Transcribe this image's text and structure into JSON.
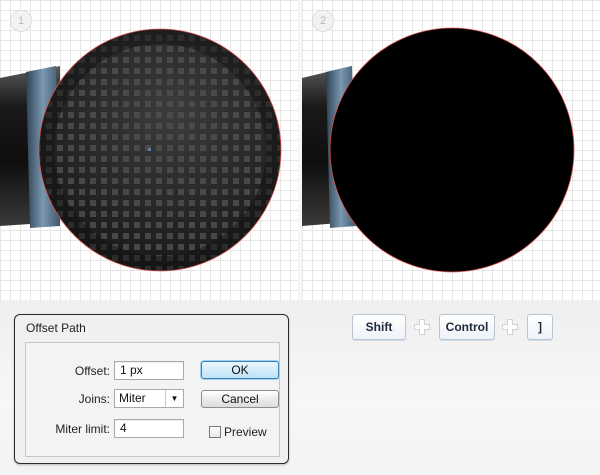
{
  "panels": [
    {
      "step": "1"
    },
    {
      "step": "2"
    }
  ],
  "dialog": {
    "title": "Offset Path",
    "offset_label": "Offset:",
    "offset_value": "1 px",
    "joins_label": "Joins:",
    "joins_value": "Miter",
    "miter_label": "Miter limit:",
    "miter_value": "4",
    "ok_label": "OK",
    "cancel_label": "Cancel",
    "preview_label": "Preview",
    "preview_checked": false
  },
  "shortcut": {
    "keys": [
      "Shift",
      "Control",
      "]"
    ],
    "separator_icon": "plus-icon"
  },
  "colors": {
    "sphere_dark": "#2b2b2b",
    "sphere_texture": "#4a4a4a",
    "circle_fill": "#000000",
    "selection_outline": "#d9534f",
    "ring_blue": "#5c7891",
    "key_border": "#b7c4d2",
    "ok_border": "#3b82b6"
  }
}
